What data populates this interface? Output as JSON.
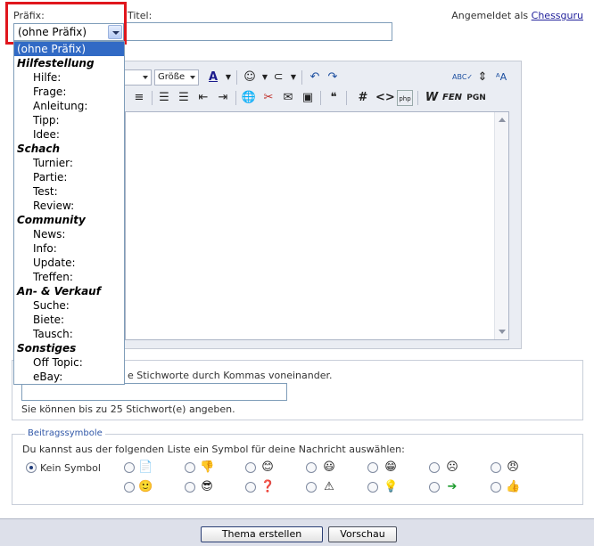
{
  "form": {
    "prefix_label": "Präfix:",
    "prefix_selected": "(ohne Präfix)",
    "title_label": "Titel:",
    "logged_in_prefix": "Angemeldet als",
    "username": "Chessguru"
  },
  "prefix_dropdown": {
    "selected": "(ohne Präfix)",
    "groups": [
      {
        "label": "Hilfestellung",
        "options": [
          "Hilfe:",
          "Frage:",
          "Anleitung:",
          "Tipp:",
          "Idee:"
        ]
      },
      {
        "label": "Schach",
        "options": [
          "Turnier:",
          "Partie:",
          "Test:",
          "Review:"
        ]
      },
      {
        "label": "Community",
        "options": [
          "News:",
          "Info:",
          "Update:",
          "Treffen:"
        ]
      },
      {
        "label": "An- & Verkauf",
        "options": [
          "Suche:",
          "Biete:",
          "Tausch:"
        ]
      },
      {
        "label": "Sonstiges",
        "options": [
          "Off Topic:",
          "eBay:"
        ]
      }
    ]
  },
  "editor": {
    "size_label": "Größe",
    "fen_label": "FEN",
    "pgn_label": "PGN",
    "hash_label": "#",
    "code_label": "<>",
    "php_label": "php"
  },
  "tags": {
    "info_text": "e Stichworte durch Kommas voneinander.",
    "limit_text": "Sie können bis zu 25 Stichwort(e) angeben."
  },
  "post_icons": {
    "legend": "Beitragssymbole",
    "description": "Du kannst aus der folgenden Liste ein Symbol für deine Nachricht auswählen:",
    "no_symbol_label": "Kein Symbol",
    "icons": [
      "page-icon",
      "thumbs-down-icon",
      "smile-icon",
      "grin-icon",
      "laugh-icon",
      "frown-icon",
      "angry-icon",
      "smile-icon",
      "cool-icon",
      "question-icon",
      "warning-icon",
      "lightbulb-icon",
      "arrow-icon",
      "thumbs-up-icon"
    ]
  },
  "buttons": {
    "create": "Thema erstellen",
    "preview": "Vorschau"
  }
}
